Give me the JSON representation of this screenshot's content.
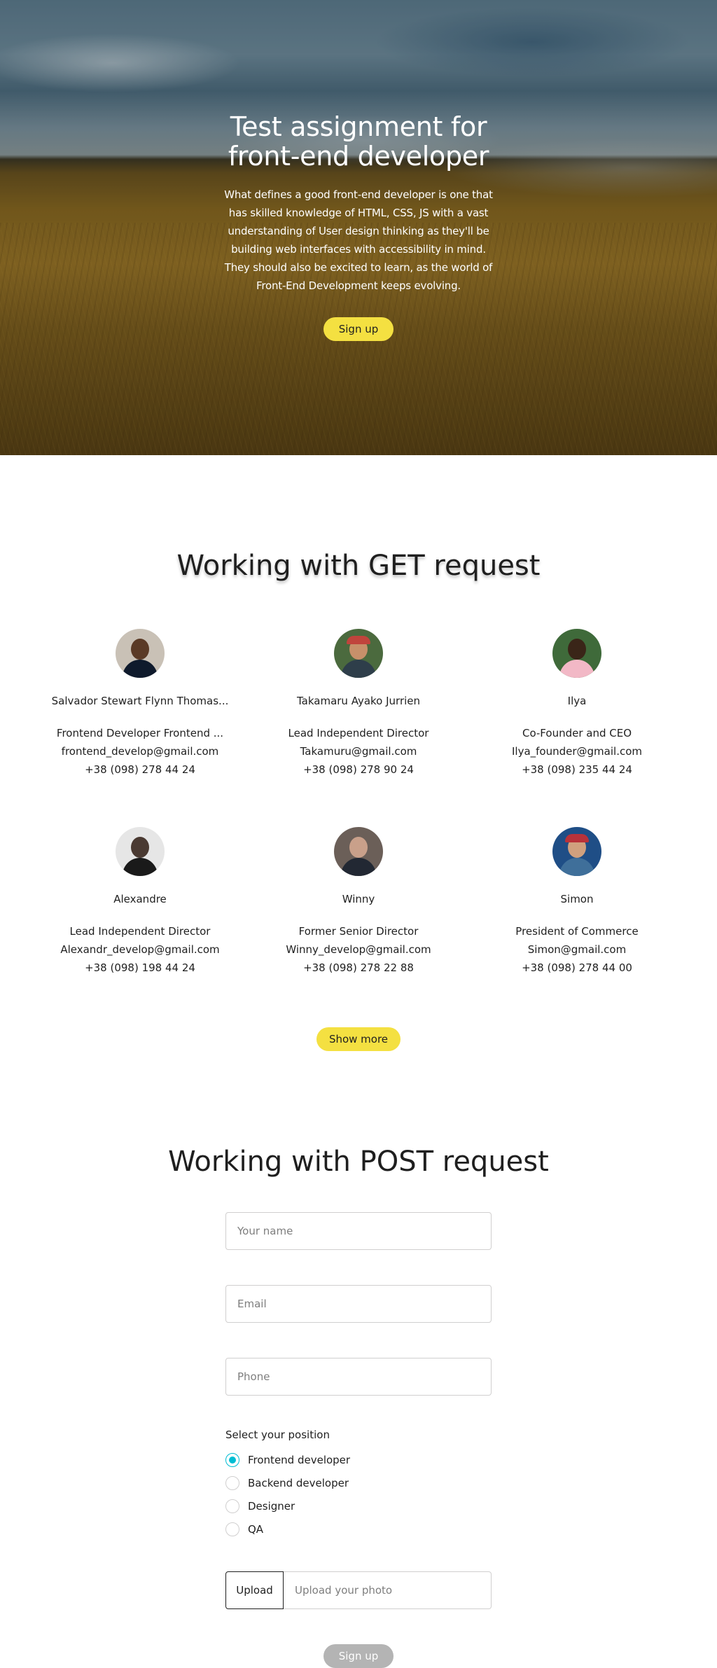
{
  "hero": {
    "title_line1": "Test assignment for",
    "title_line2": "front-end developer",
    "text": "What defines a good front-end developer is one that has skilled knowledge of HTML, CSS, JS with a vast understanding of User design thinking as they'll be building web interfaces with accessibility in mind. They should also be excited to learn, as the world of Front-End Development keeps evolving.",
    "button_label": "Sign up"
  },
  "get_section": {
    "title": "Working with GET request",
    "users": [
      {
        "name": "Salvador Stewart Flynn Thomas...",
        "position": "Frontend Developer Frontend ...",
        "email": "frontend_develop@gmail.com",
        "phone": "+38 (098) 278 44 24"
      },
      {
        "name": "Takamaru Ayako Jurrien",
        "position": "Lead Independent Director",
        "email": "Takamuru@gmail.com",
        "phone": "+38 (098) 278 90 24"
      },
      {
        "name": "Ilya",
        "position": "Co-Founder and CEO",
        "email": "Ilya_founder@gmail.com",
        "phone": "+38 (098) 235 44 24"
      },
      {
        "name": "Alexandre",
        "position": "Lead Independent Director",
        "email": "Alexandr_develop@gmail.com",
        "phone": "+38 (098) 198 44 24"
      },
      {
        "name": "Winny",
        "position": "Former Senior Director",
        "email": "Winny_develop@gmail.com",
        "phone": "+38 (098) 278 22 88"
      },
      {
        "name": "Simon",
        "position": "President of Commerce",
        "email": "Simon@gmail.com",
        "phone": "+38 (098) 278 44 00"
      }
    ],
    "show_more_label": "Show more"
  },
  "post_section": {
    "title": "Working with POST request",
    "name_placeholder": "Your name",
    "email_placeholder": "Email",
    "phone_placeholder": "Phone",
    "position_label": "Select your position",
    "positions": [
      "Frontend developer",
      "Backend developer",
      "Designer",
      "QA"
    ],
    "selected_position": "Frontend developer",
    "upload_button_label": "Upload",
    "upload_placeholder": "Upload your photo",
    "submit_label": "Sign up"
  },
  "colors": {
    "primary": "#f4e041",
    "secondary": "#00bdd3",
    "disabled": "#b4b4b4",
    "text": "#1f1f1f"
  }
}
